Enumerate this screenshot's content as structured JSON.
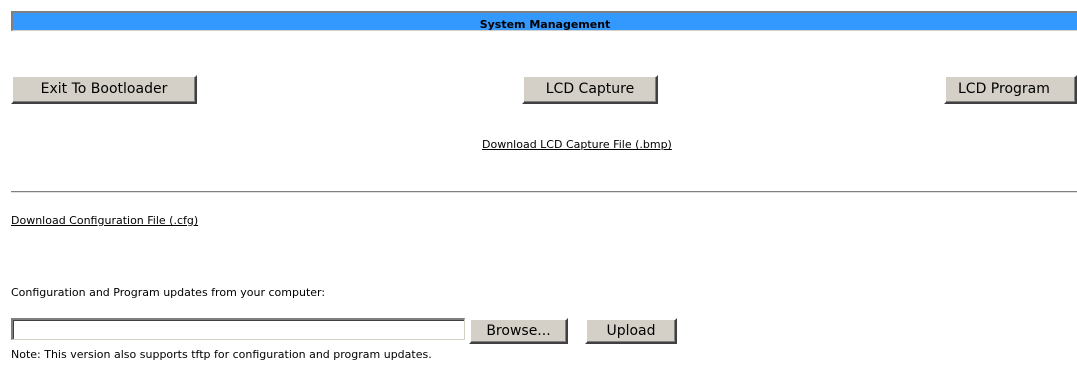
{
  "header": {
    "title": "System Management"
  },
  "actions": {
    "exit_bootloader_label": "Exit To Bootloader",
    "lcd_capture_label": "LCD Capture",
    "lcd_program_label": "LCD Program"
  },
  "links": {
    "download_lcd_capture": "Download LCD Capture File (.bmp)",
    "download_configuration": "Download Configuration File (.cfg)"
  },
  "updates": {
    "label": "Configuration and Program updates from your computer:",
    "file_value": "",
    "browse_label": "Browse...",
    "upload_label": "Upload",
    "note": "Note: This version also supports tftp for configuration and program updates."
  },
  "colors": {
    "header_background": "#3399ff",
    "button_face": "#d4d0c8"
  }
}
